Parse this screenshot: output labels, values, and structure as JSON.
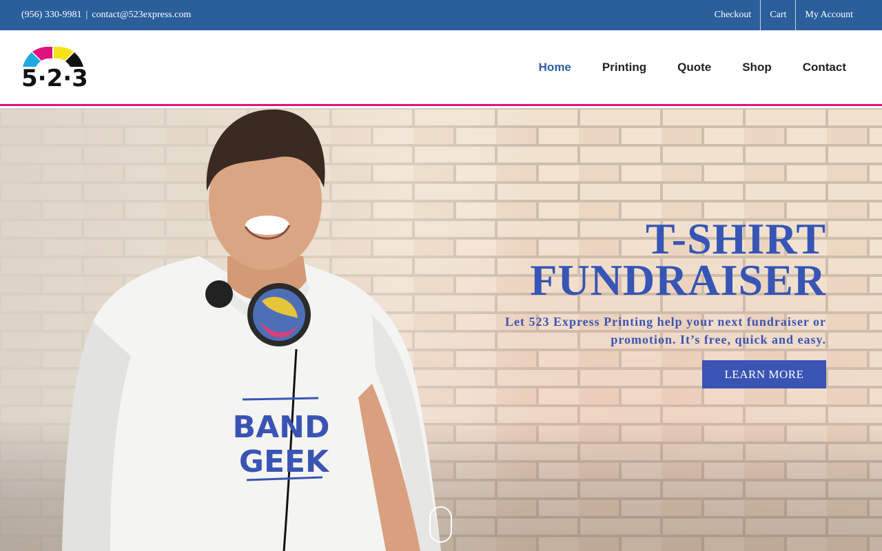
{
  "topbar": {
    "phone": "(956) 330-9981",
    "separator": "|",
    "email": "contact@523express.com",
    "links": [
      "Checkout",
      "Cart",
      "My Account"
    ],
    "background": "#2a5f9c"
  },
  "logo": {
    "text": "5·2·3",
    "arc_colors": [
      "#1fa9e1",
      "#e0127e",
      "#f5e21a",
      "#111111"
    ]
  },
  "nav": {
    "items": [
      "Home",
      "Printing",
      "Quote",
      "Shop",
      "Contact"
    ],
    "active": "Home",
    "accent": "#2a5f9c",
    "underline_color": "#e0127e"
  },
  "hero": {
    "title_line1": "T-SHIRT",
    "title_line2": "FUNDRAISER",
    "subtitle": "Let 523 Express Printing help your next fundraiser or promotion. It’s free, quick and easy.",
    "cta_label": "LEARN MORE",
    "shirt_print_line1": "BAND",
    "shirt_print_line2": "GEEK",
    "text_color": "#3a54b3"
  }
}
